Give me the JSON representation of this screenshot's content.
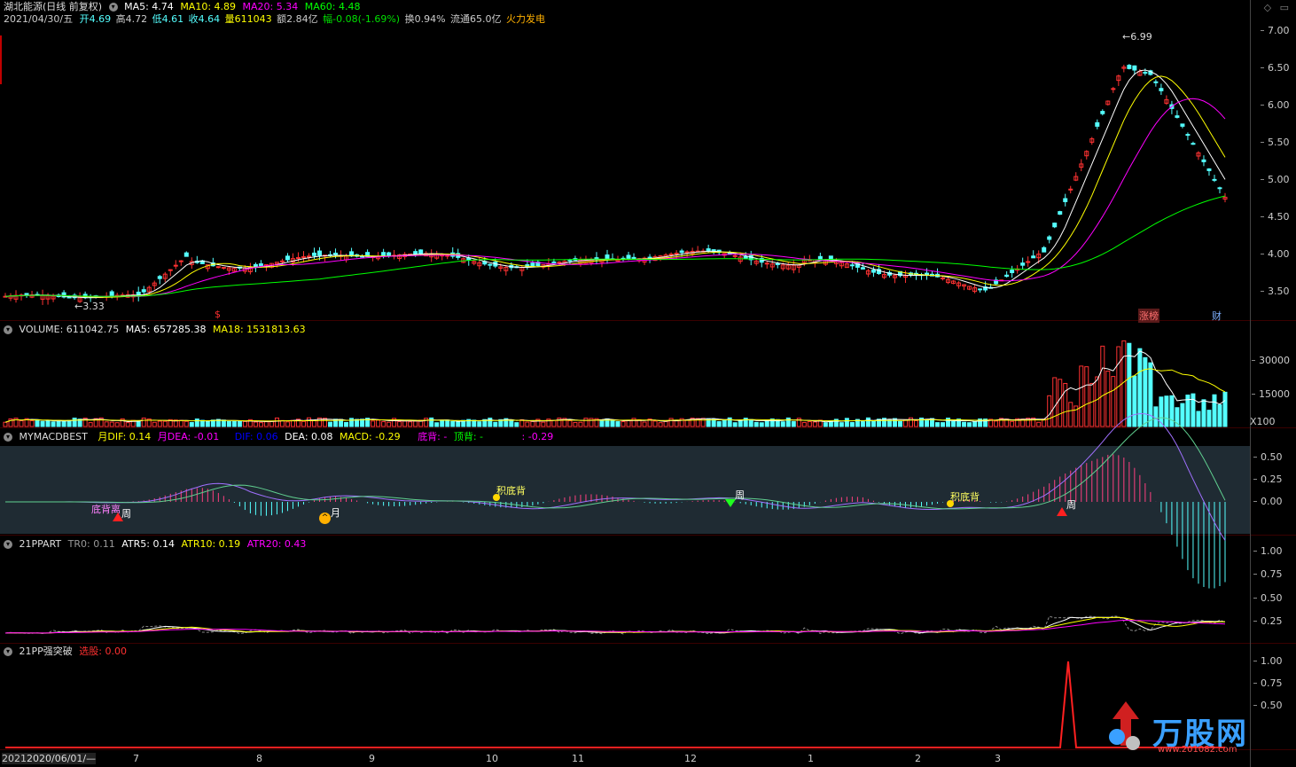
{
  "header": {
    "stock": "湖北能源(日线 前复权)",
    "ma5": "MA5: 4.74",
    "ma10": "MA10: 4.89",
    "ma20": "MA20: 5.34",
    "ma60": "MA60: 4.48",
    "date": "2021/04/30/五",
    "open": "开4.69",
    "high": "高4.72",
    "low": "低4.61",
    "close": "收4.64",
    "vol": "量611043",
    "amount": "额2.84亿",
    "change": "幅-0.08(-1.69%)",
    "turnover": "换0.94%",
    "float": "流通65.0亿",
    "concept": "火力发电",
    "colors": {
      "ma5": "#ffffff",
      "ma10": "#ffff00",
      "ma20": "#ff00ff",
      "ma60": "#00ff00",
      "up": "#ff3232",
      "down": "#54ffff"
    }
  },
  "price_pane": {
    "ticks": [
      "7.00",
      "6.50",
      "6.00",
      "5.50",
      "5.00",
      "4.50",
      "4.00",
      "3.50"
    ],
    "high_label": "6.99",
    "low_label": "3.33",
    "markers": {
      "s": "$",
      "zhangting": "涨榜",
      "cai": "财"
    }
  },
  "volume_pane": {
    "title": "VOLUME: 611042.75",
    "ma5": "MA5: 657285.38",
    "ma18": "MA18: 1531813.63",
    "ticks": [
      "30000",
      "15000"
    ],
    "unit": "X100"
  },
  "macd_pane": {
    "name": "MYMACDBEST",
    "m_dif": "月DIF: 0.14",
    "m_dea": "月DEA: -0.01",
    "dif": "DIF: 0.06",
    "dea": "DEA: 0.08",
    "macd": "MACD: -0.29",
    "dibei": "底背: -",
    "dingbei": "顶背: -",
    "other": ": -0.29",
    "ticks": [
      "0.50",
      "0.25",
      "0.00"
    ],
    "labels": {
      "dibeilabel": "底背离",
      "zhou1": "周",
      "yue": "月",
      "jidibei1": "积底背",
      "zhou2": "周",
      "jidibei2": "积底背",
      "zhou3": "周"
    }
  },
  "atr_pane": {
    "name": "21PPART",
    "tr0": "TR0: 0.11",
    "atr5": "ATR5: 0.14",
    "atr10": "ATR10: 0.19",
    "atr20": "ATR20: 0.43",
    "ticks": [
      "1.00",
      "0.75",
      "0.50",
      "0.25"
    ]
  },
  "break_pane": {
    "name": "21PP强突破",
    "select": "选股: 0.00",
    "ticks": [
      "1.00",
      "0.75",
      "0.50"
    ]
  },
  "xaxis": {
    "start": "2020/06/01/—",
    "prefix": "2021",
    "months": [
      "7",
      "8",
      "9",
      "10",
      "11",
      "12",
      "1",
      "2",
      "3"
    ]
  },
  "watermark": {
    "brand": "万股网",
    "url": "www.201082.com"
  }
}
